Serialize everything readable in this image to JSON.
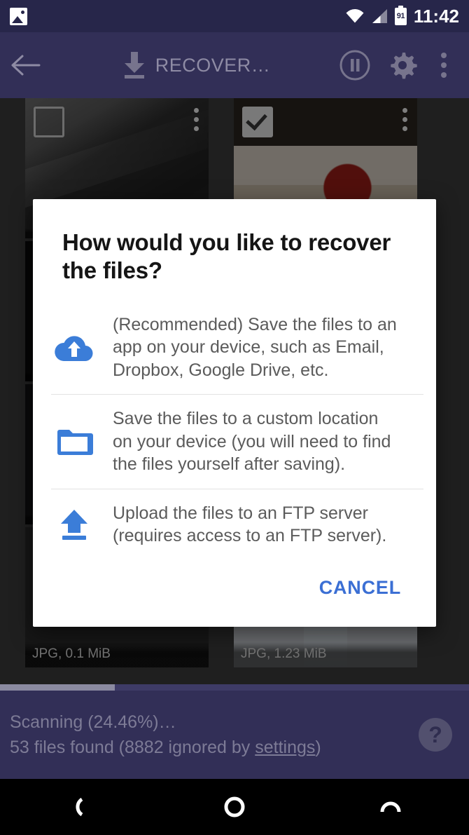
{
  "status_bar": {
    "notification_icon": "photo-icon",
    "wifi_icon": "wifi-icon",
    "signal_icon": "cellular-signal-icon",
    "battery_icon": "battery-icon",
    "battery_level": "91",
    "clock": "11:42"
  },
  "toolbar": {
    "back_icon": "arrow-back-icon",
    "download_icon": "download-icon",
    "title": "RECOVER…",
    "pause_icon": "pause-circle-icon",
    "settings_icon": "gear-icon",
    "overflow_icon": "overflow-menu-icon"
  },
  "grid": {
    "thumbnails": [
      {
        "caption": "",
        "checked": false,
        "style": "ph-dark-streak"
      },
      {
        "caption": "",
        "checked": true,
        "style": "ph-food-a"
      },
      {
        "caption": "",
        "checked": false,
        "style": "ph-black"
      },
      {
        "caption": "",
        "checked": false,
        "style": "ph-deepblue"
      },
      {
        "caption": "",
        "checked": false,
        "style": "ph-nearblack"
      },
      {
        "caption": "",
        "checked": false,
        "style": "ph-deepblue"
      },
      {
        "caption": "JPG, 0.1 MiB",
        "checked": false,
        "style": "ph-darkgrey"
      },
      {
        "caption": "JPG, 1.23 MiB",
        "checked": false,
        "style": "ph-snow"
      }
    ]
  },
  "dialog": {
    "title": "How would you like to recover the files?",
    "options": [
      {
        "icon": "cloud-upload-icon",
        "text": "(Recommended) Save the files to an app on your device, such as Email, Dropbox, Google Drive, etc."
      },
      {
        "icon": "folder-icon",
        "text": "Save the files to a custom location on your device (you will need to find the files yourself after saving)."
      },
      {
        "icon": "upload-icon",
        "text": "Upload the files to an FTP server (requires access to an FTP server)."
      }
    ],
    "cancel_label": "CANCEL"
  },
  "bottom_bar": {
    "progress_percent": 24.46,
    "scanning_text": "Scanning (24.46%)…",
    "found_prefix": "53 files found (8882 ignored by ",
    "found_link": "settings",
    "found_suffix": ")",
    "help_icon": "help-icon",
    "help_label": "?"
  },
  "nav_bar": {
    "back_label": "back-icon",
    "home_label": "home-icon",
    "recents_label": "recents-icon"
  },
  "colors": {
    "toolbar": "#322f57",
    "status_bar": "#27264a",
    "accent_blue": "#3b6fd4",
    "dialog_bg": "#ffffff"
  }
}
